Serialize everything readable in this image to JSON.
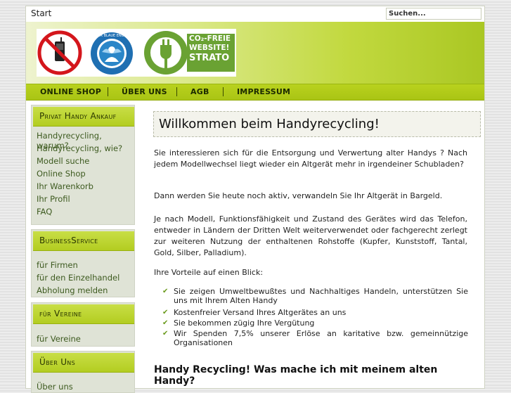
{
  "topbar": {
    "start_label": "Start",
    "search_placeholder": "Suchen..."
  },
  "header": {
    "logo_badges": [
      "Der Blaue Engel",
      "CO₂-FREIE",
      "WEBSITE!",
      "STRATO"
    ],
    "colors": {
      "accent": "#b3cd21",
      "strato_green": "#6aa233",
      "blue_angel": "#1f77b4"
    }
  },
  "nav": {
    "items": [
      "ONLINE SHOP",
      "ÜBER UNS",
      "AGB",
      "IMPRESSUM"
    ]
  },
  "sidebar": {
    "boxes": [
      {
        "title": "Privat Handy Ankauf",
        "links": [
          "Handyrecycling, warum?",
          "Handyrecycling, wie?",
          "Modell suche",
          "Online Shop",
          "Ihr Warenkorb",
          "Ihr Profil",
          "FAQ"
        ]
      },
      {
        "title": "BusinessService",
        "links": [
          "für Firmen",
          "für den Einzelhandel",
          "Abholung melden"
        ]
      },
      {
        "title": "für Vereine",
        "links": [
          "für Vereine"
        ]
      },
      {
        "title": "Über Uns",
        "links": [
          "Über uns"
        ]
      }
    ]
  },
  "content": {
    "title": "Willkommen beim Handyrecycling!",
    "p1": "Sie interessieren sich für die Entsorgung und Verwertung alter Handys ? Nach jedem Modellwechsel liegt wieder ein Altgerät mehr in irgendeiner Schubladen?",
    "p2": "Dann werden Sie heute noch aktiv, verwandeln Sie Ihr Altgerät in Bargeld.",
    "p3": "Je nach Modell, Funktionsfähigkeit und Zustand des Gerätes wird das Telefon, entweder in Ländern der Dritten Welt weiterverwendet oder fachgerecht zerlegt zur weiteren Nutzung der enthaltenen Rohstoffe (Kupfer, Kunststoff, Tantal, Gold, Silber, Palladium).",
    "p4": "Ihre Vorteile auf einen Blick:",
    "benefits": [
      "Sie zeigen Umweltbewußtes und Nachhaltiges Handeln, unterstützen Sie uns mit Ihrem Alten Handy",
      "Kostenfreier Versand Ihres Altgerätes an uns",
      "Sie bekommen zügig Ihre Vergütung",
      "Wir Spenden 7,5% unserer Erlöse an karitative bzw. gemeinnützige Organisationen"
    ],
    "heading2": "Handy Recycling! Was mache ich mit meinem alten Handy?"
  }
}
